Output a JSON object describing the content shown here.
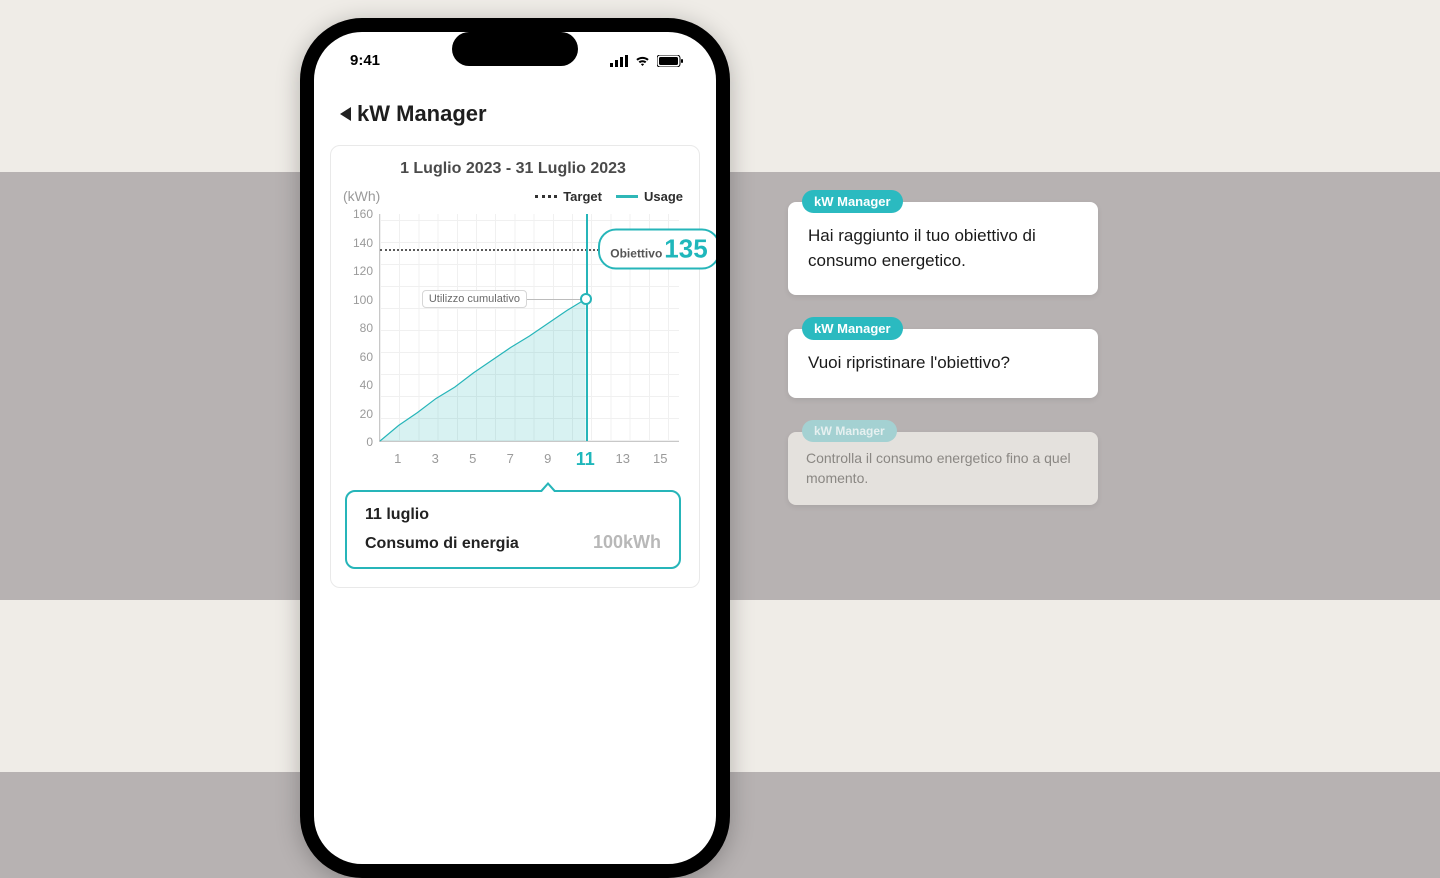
{
  "statusbar": {
    "time": "9:41"
  },
  "app": {
    "title": "kW Manager",
    "date_range": "1 Luglio 2023 - 31 Luglio 2023",
    "unit": "(kWh)",
    "legend": {
      "target": "Target",
      "usage": "Usage"
    },
    "util_label": "Utilizzo cumulativo",
    "goal": {
      "label": "Obiettivo",
      "value": "135"
    },
    "summary": {
      "date": "11 luglio",
      "label": "Consumo di energia",
      "value": "100kWh"
    }
  },
  "chart_data": {
    "type": "line",
    "title": "",
    "xlabel": "",
    "ylabel": "(kWh)",
    "ylim": [
      0,
      160
    ],
    "xlim": [
      0,
      16
    ],
    "x_ticks": [
      1,
      3,
      5,
      7,
      9,
      11,
      13,
      15
    ],
    "y_ticks": [
      0,
      20,
      40,
      60,
      80,
      100,
      120,
      140,
      160
    ],
    "series": [
      {
        "name": "Usage",
        "x": [
          0,
          1,
          2,
          3,
          4,
          5,
          6,
          7,
          8,
          9,
          10,
          11
        ],
        "y": [
          0,
          11,
          20,
          30,
          38,
          48,
          57,
          66,
          74,
          83,
          92,
          100
        ]
      }
    ],
    "target_line": 135,
    "current_x": 11,
    "highlight_tick": 11
  },
  "colors": {
    "accent": "#26b5b9"
  },
  "notifs": [
    {
      "tag": "kW Manager",
      "text": "Hai raggiunto il tuo obiettivo di consumo energetico.",
      "dim": false
    },
    {
      "tag": "kW Manager",
      "text": "Vuoi ripristinare l'obiettivo?",
      "dim": false
    },
    {
      "tag": "kW Manager",
      "text": "Controlla il consumo energetico fino a quel momento.",
      "dim": true
    }
  ]
}
